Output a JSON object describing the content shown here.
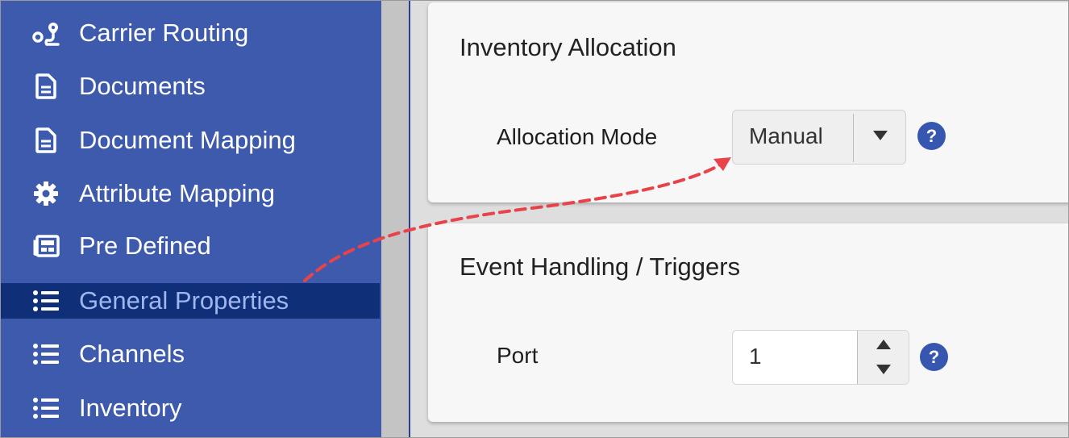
{
  "sidebar": {
    "items": [
      {
        "label": "Carrier Routing",
        "icon": "route-icon",
        "active": false
      },
      {
        "label": "Documents",
        "icon": "document-icon",
        "active": false
      },
      {
        "label": "Document Mapping",
        "icon": "document-icon",
        "active": false
      },
      {
        "label": "Attribute Mapping",
        "icon": "gear-icon",
        "active": false
      },
      {
        "label": "Pre Defined",
        "icon": "newspaper-icon",
        "active": false
      },
      {
        "label": "General Properties",
        "icon": "list-icon",
        "active": true
      },
      {
        "label": "Channels",
        "icon": "list-icon",
        "active": false
      },
      {
        "label": "Inventory",
        "icon": "list-icon",
        "active": false
      }
    ]
  },
  "inventory_allocation": {
    "title": "Inventory Allocation",
    "allocation_mode_label": "Allocation Mode",
    "allocation_mode_value": "Manual",
    "help_glyph": "?"
  },
  "event_handling": {
    "title": "Event Handling / Triggers",
    "port_label": "Port",
    "port_value": "1",
    "help_glyph": "?"
  },
  "colors": {
    "sidebar_bg": "#3d5aad",
    "sidebar_active_bg": "#0f2f78",
    "sidebar_active_text": "#9fb6ee",
    "help_icon_bg": "#3756b0",
    "annotation_arrow": "#e8424a"
  }
}
